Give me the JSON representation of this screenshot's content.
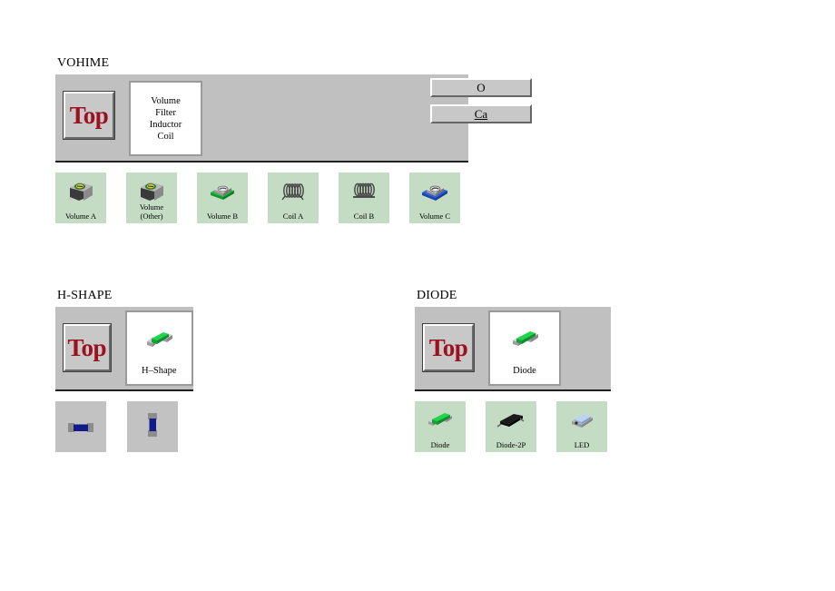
{
  "sections": {
    "vohime": {
      "title": "VOHIME",
      "top_button": "Top",
      "card_text": "Volume\nFilter\nInductor\nCoil",
      "edge_buttons": [
        {
          "label": "O",
          "truncated": true
        },
        {
          "label": "Ca",
          "truncated": true
        }
      ],
      "tiles": [
        {
          "label": "Volume A",
          "icon": "trimmer-pot-green-icon",
          "bg": "#c4dcc4"
        },
        {
          "label": "Volume\n(Other)",
          "icon": "trimmer-pot-green-icon",
          "bg": "#c4dcc4"
        },
        {
          "label": "Volume B",
          "icon": "trimmer-pot-screw-green-icon",
          "bg": "#c4dcc4"
        },
        {
          "label": "Coil A",
          "icon": "coil-inductor-icon",
          "bg": "#c4dcc4"
        },
        {
          "label": "Coil B",
          "icon": "coil-inductor-icon",
          "bg": "#c4dcc4"
        },
        {
          "label": "Volume C",
          "icon": "trimmer-pot-blue-icon",
          "bg": "#c4dcc4"
        }
      ]
    },
    "hshape": {
      "title": "H-SHAPE",
      "top_button": "Top",
      "card_label": "H–Shape",
      "card_icon": "chip-green-icon",
      "tiles": [
        {
          "label": "",
          "icon": "h-shape-horizontal-icon",
          "bg": "#c2c2c2"
        },
        {
          "label": "",
          "icon": "h-shape-vertical-icon",
          "bg": "#c2c2c2"
        }
      ]
    },
    "diode": {
      "title": "DIODE",
      "top_button": "Top",
      "card_label": "Diode",
      "card_icon": "chip-green-icon",
      "tiles": [
        {
          "label": "Diode",
          "icon": "chip-green-icon",
          "bg": "#c4dcc4"
        },
        {
          "label": "Diode-2P",
          "icon": "diode-black-2p-icon",
          "bg": "#c4dcc4"
        },
        {
          "label": "LED",
          "icon": "led-blue-icon",
          "bg": "#c4dcc4"
        }
      ]
    }
  },
  "colors": {
    "panel_bg": "#c0c0c0",
    "tile_green": "#c4dcc4",
    "tile_gray": "#c2c2c2",
    "top_text": "#9c1120",
    "card_bg": "#ffffff"
  }
}
